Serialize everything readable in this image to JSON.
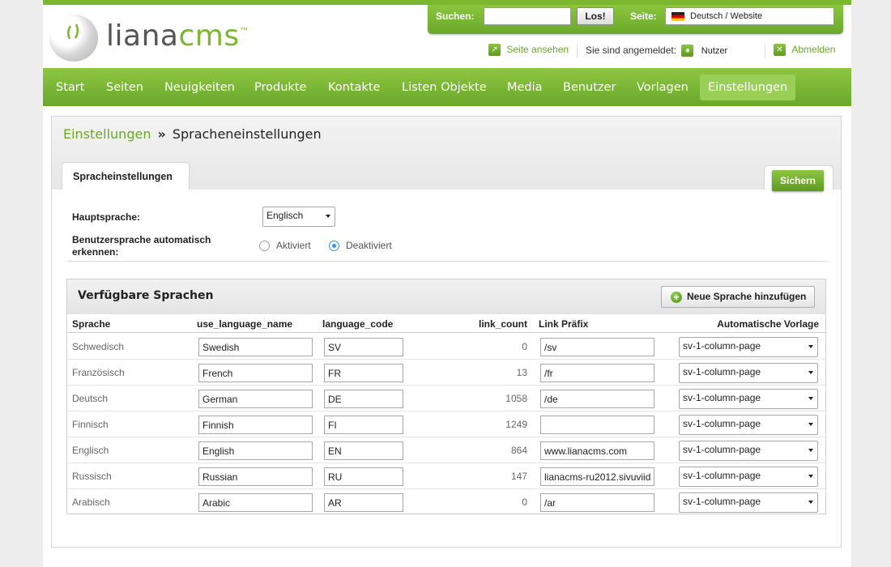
{
  "header": {
    "logo_text_main": "liana",
    "logo_text_accent": "cms",
    "logo_tm": "™",
    "search_label": "Suchen:",
    "search_value": "",
    "search_button": "Los!",
    "site_label": "Seite:",
    "site_value": "Deutsch / Website",
    "view_site": "Seite ansehen",
    "logged_in_label": "Sie sind angemeldet:",
    "user_name": "Nutzer",
    "logout": "Abmelden"
  },
  "nav": {
    "items": [
      "Start",
      "Seiten",
      "Neuigkeiten",
      "Produkte",
      "Kontakte",
      "Listen Objekte",
      "Media",
      "Benutzer",
      "Vorlagen",
      "Einstellungen"
    ],
    "active": "Einstellungen"
  },
  "breadcrumb": {
    "parent": "Einstellungen",
    "separator": "»",
    "current": "Spracheneinstellungen"
  },
  "tab": {
    "label": "Spracheinstellungen"
  },
  "save_button": "Sichern",
  "form": {
    "main_language_label": "Hauptsprache:",
    "main_language_value": "Englisch",
    "auto_detect_label_1": "Benutzersprache automatisch",
    "auto_detect_label_2": "erkennen:",
    "option_on": "Aktiviert",
    "option_off": "Deaktiviert",
    "selected": "Deaktiviert"
  },
  "languages": {
    "title": "Verfügbare Sprachen",
    "add_button": "Neue Sprache hinzufügen",
    "columns": [
      "Sprache",
      "use_language_name",
      "language_code",
      "link_count",
      "Link Präfix",
      "Automatische Vorlage"
    ],
    "rows": [
      {
        "sprache": "Schwedisch",
        "name": "Swedish",
        "code": "SV",
        "count": "0",
        "prefix": "/sv",
        "template": "sv-1-column-page"
      },
      {
        "sprache": "Französisch",
        "name": "French",
        "code": "FR",
        "count": "13",
        "prefix": "/fr",
        "template": "sv-1-column-page"
      },
      {
        "sprache": "Deutsch",
        "name": "German",
        "code": "DE",
        "count": "1058",
        "prefix": "/de",
        "template": "sv-1-column-page"
      },
      {
        "sprache": "Finnisch",
        "name": "Finnish",
        "code": "FI",
        "count": "1249",
        "prefix": "",
        "template": "sv-1-column-page"
      },
      {
        "sprache": "Englisch",
        "name": "English",
        "code": "EN",
        "count": "864",
        "prefix": "www.lianacms.com",
        "template": "sv-1-column-page"
      },
      {
        "sprache": "Russisch",
        "name": "Russian",
        "code": "RU",
        "count": "147",
        "prefix": "lianacms-ru2012.sivuviid",
        "template": "sv-1-column-page"
      },
      {
        "sprache": "Arabisch",
        "name": "Arabic",
        "code": "AR",
        "count": "0",
        "prefix": "/ar",
        "template": "sv-1-column-page"
      }
    ]
  },
  "colors": {
    "brand_green": "#7cb82f",
    "nav_active": "#9acf57",
    "link_green": "#6aa82a"
  }
}
